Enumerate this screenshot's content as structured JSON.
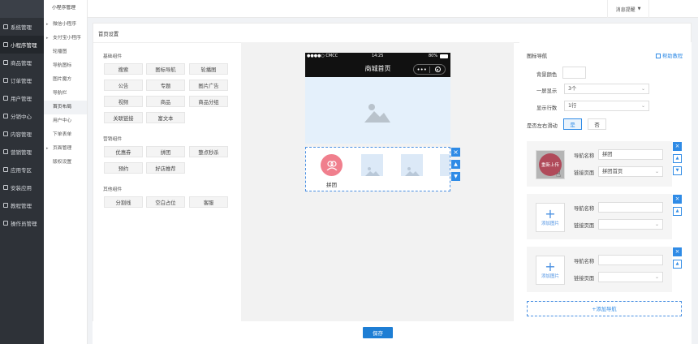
{
  "leftnav": {
    "items": [
      {
        "label": "系统管理",
        "icon": "gear-icon"
      },
      {
        "label": "小程序管理",
        "icon": "link-icon"
      },
      {
        "label": "商品管理",
        "icon": "box-icon"
      },
      {
        "label": "订单管理",
        "icon": "list-icon"
      },
      {
        "label": "用户管理",
        "icon": "user-icon"
      },
      {
        "label": "分销中心",
        "icon": "share-icon"
      },
      {
        "label": "内容管理",
        "icon": "doc-icon"
      },
      {
        "label": "营销管理",
        "icon": "cart-icon"
      },
      {
        "label": "应用专区",
        "icon": "grid-icon"
      },
      {
        "label": "安装应用",
        "icon": "install-icon"
      },
      {
        "label": "教程管理",
        "icon": "book-icon"
      },
      {
        "label": "操作员管理",
        "icon": "gear-icon"
      }
    ]
  },
  "subnav": {
    "items": [
      {
        "label": "小程序管理"
      },
      {
        "label": "微信小程序"
      },
      {
        "label": "支付宝小程序"
      },
      {
        "label": "轮播图"
      },
      {
        "label": "导航图标"
      },
      {
        "label": "图片魔方"
      },
      {
        "label": "导航栏"
      },
      {
        "label": "首页布局"
      },
      {
        "label": "用户中心"
      },
      {
        "label": "下单表单"
      },
      {
        "label": "页面管理"
      },
      {
        "label": "版权设置"
      }
    ]
  },
  "topbar": {
    "msg_label": "消息提醒"
  },
  "content": {
    "title": "首页设置",
    "basic_title": "基础组件",
    "basic": [
      "搜索",
      "图标导航",
      "轮播图",
      "公告",
      "专题",
      "图片广告",
      "视频",
      "商品",
      "商品分组",
      "关联链接",
      "富文本"
    ],
    "marketing_title": "营销组件",
    "marketing": [
      "优惠券",
      "拼团",
      "整点秒杀",
      "预约",
      "好店推荐"
    ],
    "other_title": "其他组件",
    "other": [
      "分割线",
      "空白占位",
      "客服"
    ]
  },
  "phone": {
    "carrier": "●●●●○ CMCC",
    "time": "14:25",
    "battery": "80%",
    "title": "商城首页",
    "nav_item_label": "拼团"
  },
  "panel": {
    "title": "图标导航",
    "help": "帮助教程",
    "bg_label": "背景颜色",
    "per_screen_label": "一屏显示",
    "per_screen_value": "3个",
    "rows_label": "显示行数",
    "rows_value": "1行",
    "scroll_label": "是否左右滑动",
    "yes": "是",
    "no": "否",
    "cards": [
      {
        "name_label": "导航名称",
        "name_value": "拼团",
        "link_label": "链接页面",
        "link_value": "拼团首页",
        "reupload": "重新上传"
      },
      {
        "name_label": "导航名称",
        "name_value": "",
        "link_label": "链接页面",
        "link_value": "",
        "add_image": "添加图片"
      },
      {
        "name_label": "导航名称",
        "name_value": "",
        "link_label": "链接页面",
        "link_value": "",
        "add_image": "添加图片"
      }
    ],
    "add_nav": "+添加导航",
    "accent": "#2f8be6"
  },
  "save_label": "保存"
}
